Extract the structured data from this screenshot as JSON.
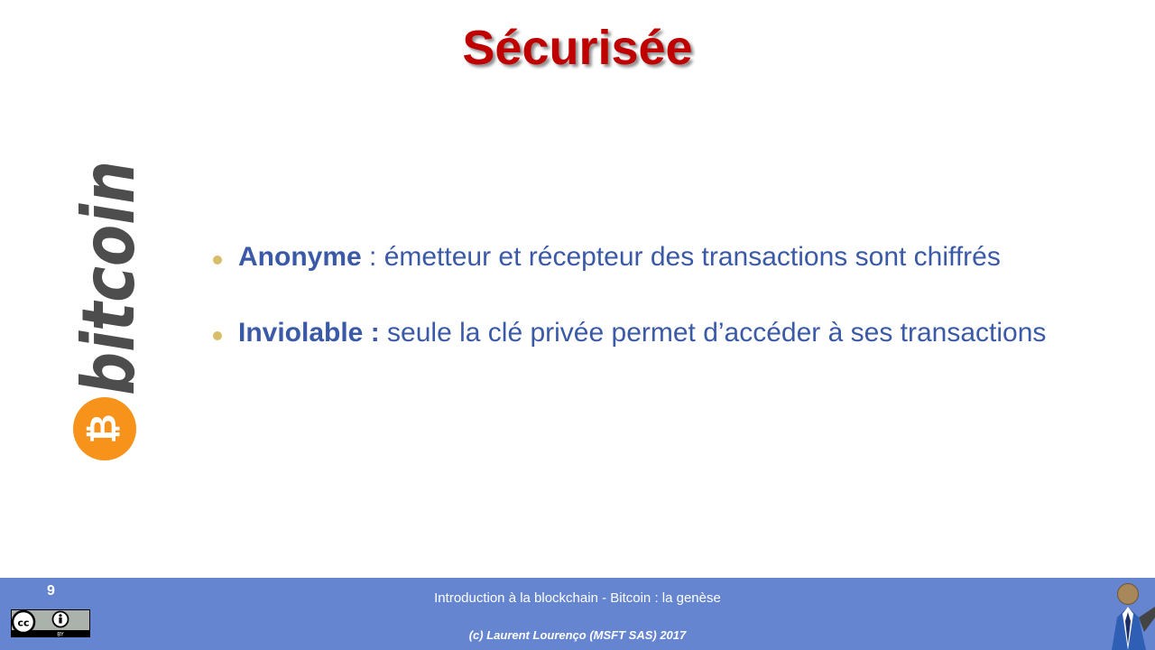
{
  "slide": {
    "title": "Sécurisée",
    "logo_text": "bitcoin",
    "logo_symbol": "₿",
    "bullets": [
      {
        "strong": "Anonyme",
        "text": " : émetteur et récepteur des transactions sont chiffrés"
      },
      {
        "strong": "Inviolable :",
        "text": " seule la clé privée permet d’accéder à ses transactions"
      }
    ]
  },
  "footer": {
    "slide_number": "9",
    "title": "Introduction  à la blockchain - Bitcoin : la genèse",
    "copyright": "(c) Laurent Lourenço (MSFT SAS) 2017",
    "license_badge": "cc BY"
  },
  "colors": {
    "title": "#c00000",
    "bullet_text": "#3a59a6",
    "bullet_dot": "#d8bd6a",
    "footer_bg": "#6585d0",
    "bitcoin_orange": "#f7931a",
    "bitcoin_grey": "#4d4d4d"
  },
  "icons": {
    "logo": "bitcoin-logo-icon",
    "license": "creative-commons-by-icon",
    "person": "presenter-avatar-icon"
  }
}
